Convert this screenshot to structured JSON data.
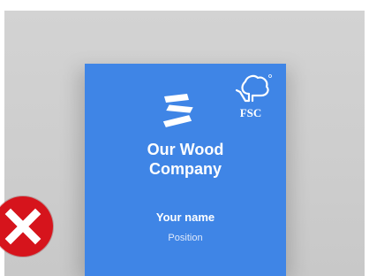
{
  "mockup": {
    "company_line1": "Our Wood",
    "company_line2": "Company",
    "person_name": "Your name",
    "person_position": "Position",
    "fsc_text": "FSC"
  },
  "icons": {
    "brand_logo": "wood-company-logo-icon",
    "certification": "fsc-tree-logo-icon",
    "close": "close-icon"
  },
  "colors": {
    "card": "#3f85e6",
    "backdrop": "#cfcfcf",
    "close_badge": "#d6141c",
    "text": "#ffffff"
  }
}
